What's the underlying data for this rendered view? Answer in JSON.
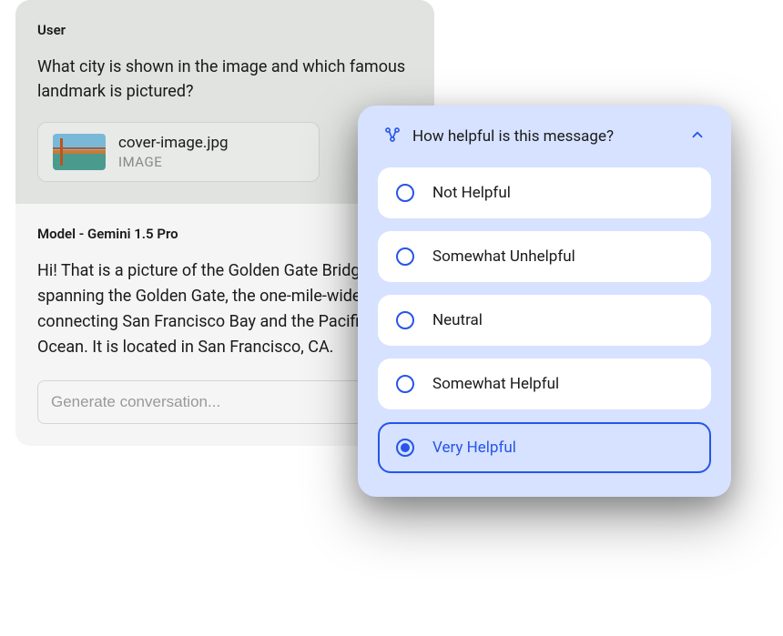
{
  "chat": {
    "user": {
      "label": "User",
      "message": "What city is shown in the image and which famous landmark is pictured?",
      "attachment": {
        "filename": "cover-image.jpg",
        "type": "IMAGE"
      }
    },
    "model": {
      "label": "Model - Gemini 1.5 Pro",
      "message": "Hi! That is a picture of the Golden Gate Bridge spanning the Golden Gate, the one-mile-wide strait connecting San Francisco Bay and the Pacific Ocean. It is located in San Francisco, CA."
    },
    "input": {
      "placeholder": "Generate conversation..."
    }
  },
  "rating": {
    "title": "How helpful is this message?",
    "options": [
      {
        "label": "Not Helpful",
        "selected": false
      },
      {
        "label": "Somewhat Unhelpful",
        "selected": false
      },
      {
        "label": "Neutral",
        "selected": false
      },
      {
        "label": "Somewhat Helpful",
        "selected": false
      },
      {
        "label": "Very Helpful",
        "selected": true
      }
    ]
  }
}
